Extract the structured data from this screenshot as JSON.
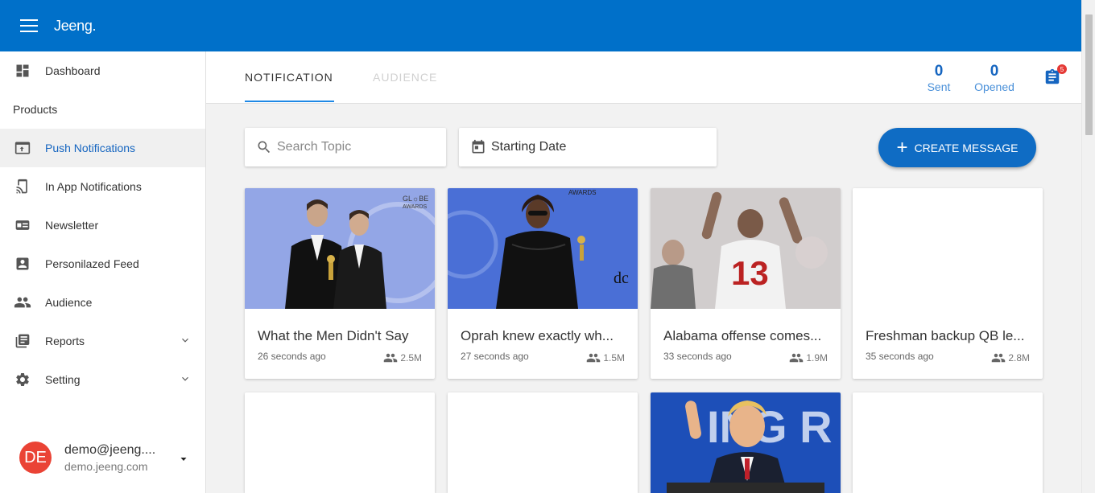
{
  "app": {
    "brand": "Jeeng."
  },
  "sidebar": {
    "items": [
      {
        "label": "Dashboard",
        "icon": "dashboard-icon"
      },
      {
        "label": "Products",
        "section": true
      },
      {
        "label": "Push Notifications",
        "icon": "push-notification-icon",
        "active": true
      },
      {
        "label": "In App Notifications",
        "icon": "cast-icon"
      },
      {
        "label": "Newsletter",
        "icon": "newsletter-icon"
      },
      {
        "label": "Personilazed Feed",
        "icon": "account-box-icon"
      },
      {
        "label": "Audience",
        "icon": "people-icon"
      },
      {
        "label": "Reports",
        "icon": "reports-icon",
        "expandable": true
      },
      {
        "label": "Setting",
        "icon": "settings-icon",
        "expandable": true
      }
    ],
    "user": {
      "initials": "DE",
      "email": "demo@jeeng....",
      "domain": "demo.jeeng.com"
    }
  },
  "header": {
    "tabs": [
      {
        "label": "NOTIFICATION",
        "active": true
      },
      {
        "label": "AUDIENCE",
        "active": false
      }
    ],
    "stats": [
      {
        "value": "0",
        "label": "Sent"
      },
      {
        "value": "0",
        "label": "Opened"
      }
    ],
    "badge_count": "5"
  },
  "toolbar": {
    "search_placeholder": "Search Topic",
    "date_label": "Starting Date",
    "create_label": "CREATE MESSAGE"
  },
  "cards": [
    {
      "title": "What the Men Didn't Say",
      "time": "26 seconds ago",
      "reach": "2.5M"
    },
    {
      "title": "Oprah knew exactly wh...",
      "time": "27 seconds ago",
      "reach": "1.5M"
    },
    {
      "title": "Alabama offense comes...",
      "time": "33 seconds ago",
      "reach": "1.9M"
    },
    {
      "title": "Freshman backup QB le...",
      "time": "35 seconds ago",
      "reach": "2.8M"
    }
  ],
  "colors": {
    "primary": "#0070c9",
    "accent": "#1e88e5",
    "avatar": "#ea4335",
    "badge": "#e53935"
  }
}
